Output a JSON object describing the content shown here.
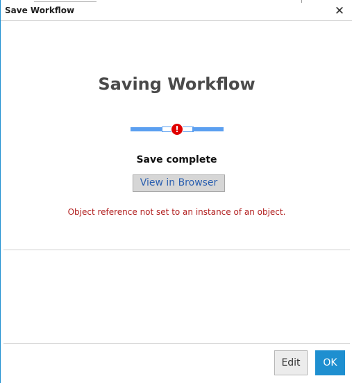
{
  "window": {
    "title": "Save Workflow",
    "close_glyph": "✕",
    "close_icon": "close-icon"
  },
  "main": {
    "heading": "Saving Workflow",
    "status": "Save complete",
    "view_in_browser_label": "View in Browser",
    "error_message": "Object reference not set to an instance of an object.",
    "error_icon": "error-icon",
    "error_glyph": "!"
  },
  "footer": {
    "edit_label": "Edit",
    "ok_label": "OK"
  },
  "colors": {
    "accent": "#1e8fd0",
    "progress": "#5b9ff0",
    "error": "#e00000",
    "error_text": "#b22020"
  }
}
